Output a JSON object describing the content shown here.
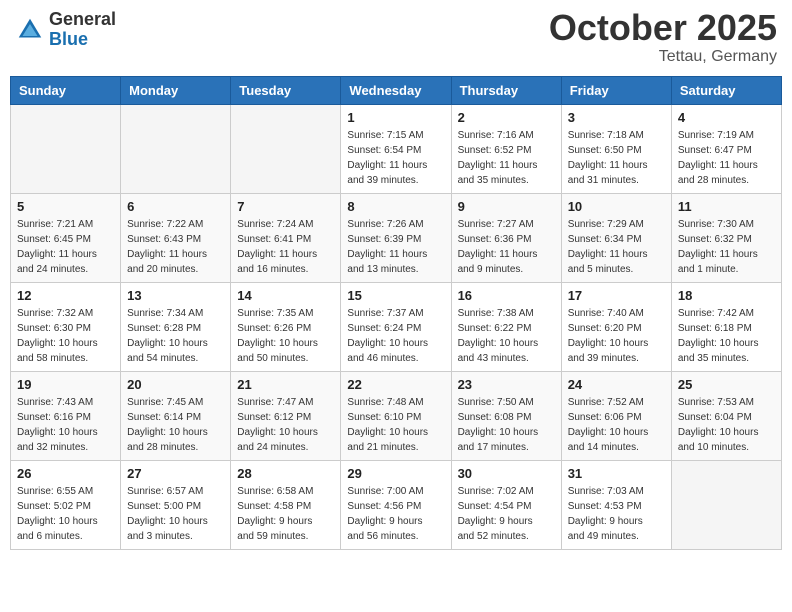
{
  "header": {
    "logo_general": "General",
    "logo_blue": "Blue",
    "month": "October 2025",
    "location": "Tettau, Germany"
  },
  "weekdays": [
    "Sunday",
    "Monday",
    "Tuesday",
    "Wednesday",
    "Thursday",
    "Friday",
    "Saturday"
  ],
  "weeks": [
    [
      {
        "day": "",
        "info": ""
      },
      {
        "day": "",
        "info": ""
      },
      {
        "day": "",
        "info": ""
      },
      {
        "day": "1",
        "info": "Sunrise: 7:15 AM\nSunset: 6:54 PM\nDaylight: 11 hours\nand 39 minutes."
      },
      {
        "day": "2",
        "info": "Sunrise: 7:16 AM\nSunset: 6:52 PM\nDaylight: 11 hours\nand 35 minutes."
      },
      {
        "day": "3",
        "info": "Sunrise: 7:18 AM\nSunset: 6:50 PM\nDaylight: 11 hours\nand 31 minutes."
      },
      {
        "day": "4",
        "info": "Sunrise: 7:19 AM\nSunset: 6:47 PM\nDaylight: 11 hours\nand 28 minutes."
      }
    ],
    [
      {
        "day": "5",
        "info": "Sunrise: 7:21 AM\nSunset: 6:45 PM\nDaylight: 11 hours\nand 24 minutes."
      },
      {
        "day": "6",
        "info": "Sunrise: 7:22 AM\nSunset: 6:43 PM\nDaylight: 11 hours\nand 20 minutes."
      },
      {
        "day": "7",
        "info": "Sunrise: 7:24 AM\nSunset: 6:41 PM\nDaylight: 11 hours\nand 16 minutes."
      },
      {
        "day": "8",
        "info": "Sunrise: 7:26 AM\nSunset: 6:39 PM\nDaylight: 11 hours\nand 13 minutes."
      },
      {
        "day": "9",
        "info": "Sunrise: 7:27 AM\nSunset: 6:36 PM\nDaylight: 11 hours\nand 9 minutes."
      },
      {
        "day": "10",
        "info": "Sunrise: 7:29 AM\nSunset: 6:34 PM\nDaylight: 11 hours\nand 5 minutes."
      },
      {
        "day": "11",
        "info": "Sunrise: 7:30 AM\nSunset: 6:32 PM\nDaylight: 11 hours\nand 1 minute."
      }
    ],
    [
      {
        "day": "12",
        "info": "Sunrise: 7:32 AM\nSunset: 6:30 PM\nDaylight: 10 hours\nand 58 minutes."
      },
      {
        "day": "13",
        "info": "Sunrise: 7:34 AM\nSunset: 6:28 PM\nDaylight: 10 hours\nand 54 minutes."
      },
      {
        "day": "14",
        "info": "Sunrise: 7:35 AM\nSunset: 6:26 PM\nDaylight: 10 hours\nand 50 minutes."
      },
      {
        "day": "15",
        "info": "Sunrise: 7:37 AM\nSunset: 6:24 PM\nDaylight: 10 hours\nand 46 minutes."
      },
      {
        "day": "16",
        "info": "Sunrise: 7:38 AM\nSunset: 6:22 PM\nDaylight: 10 hours\nand 43 minutes."
      },
      {
        "day": "17",
        "info": "Sunrise: 7:40 AM\nSunset: 6:20 PM\nDaylight: 10 hours\nand 39 minutes."
      },
      {
        "day": "18",
        "info": "Sunrise: 7:42 AM\nSunset: 6:18 PM\nDaylight: 10 hours\nand 35 minutes."
      }
    ],
    [
      {
        "day": "19",
        "info": "Sunrise: 7:43 AM\nSunset: 6:16 PM\nDaylight: 10 hours\nand 32 minutes."
      },
      {
        "day": "20",
        "info": "Sunrise: 7:45 AM\nSunset: 6:14 PM\nDaylight: 10 hours\nand 28 minutes."
      },
      {
        "day": "21",
        "info": "Sunrise: 7:47 AM\nSunset: 6:12 PM\nDaylight: 10 hours\nand 24 minutes."
      },
      {
        "day": "22",
        "info": "Sunrise: 7:48 AM\nSunset: 6:10 PM\nDaylight: 10 hours\nand 21 minutes."
      },
      {
        "day": "23",
        "info": "Sunrise: 7:50 AM\nSunset: 6:08 PM\nDaylight: 10 hours\nand 17 minutes."
      },
      {
        "day": "24",
        "info": "Sunrise: 7:52 AM\nSunset: 6:06 PM\nDaylight: 10 hours\nand 14 minutes."
      },
      {
        "day": "25",
        "info": "Sunrise: 7:53 AM\nSunset: 6:04 PM\nDaylight: 10 hours\nand 10 minutes."
      }
    ],
    [
      {
        "day": "26",
        "info": "Sunrise: 6:55 AM\nSunset: 5:02 PM\nDaylight: 10 hours\nand 6 minutes."
      },
      {
        "day": "27",
        "info": "Sunrise: 6:57 AM\nSunset: 5:00 PM\nDaylight: 10 hours\nand 3 minutes."
      },
      {
        "day": "28",
        "info": "Sunrise: 6:58 AM\nSunset: 4:58 PM\nDaylight: 9 hours\nand 59 minutes."
      },
      {
        "day": "29",
        "info": "Sunrise: 7:00 AM\nSunset: 4:56 PM\nDaylight: 9 hours\nand 56 minutes."
      },
      {
        "day": "30",
        "info": "Sunrise: 7:02 AM\nSunset: 4:54 PM\nDaylight: 9 hours\nand 52 minutes."
      },
      {
        "day": "31",
        "info": "Sunrise: 7:03 AM\nSunset: 4:53 PM\nDaylight: 9 hours\nand 49 minutes."
      },
      {
        "day": "",
        "info": ""
      }
    ]
  ]
}
